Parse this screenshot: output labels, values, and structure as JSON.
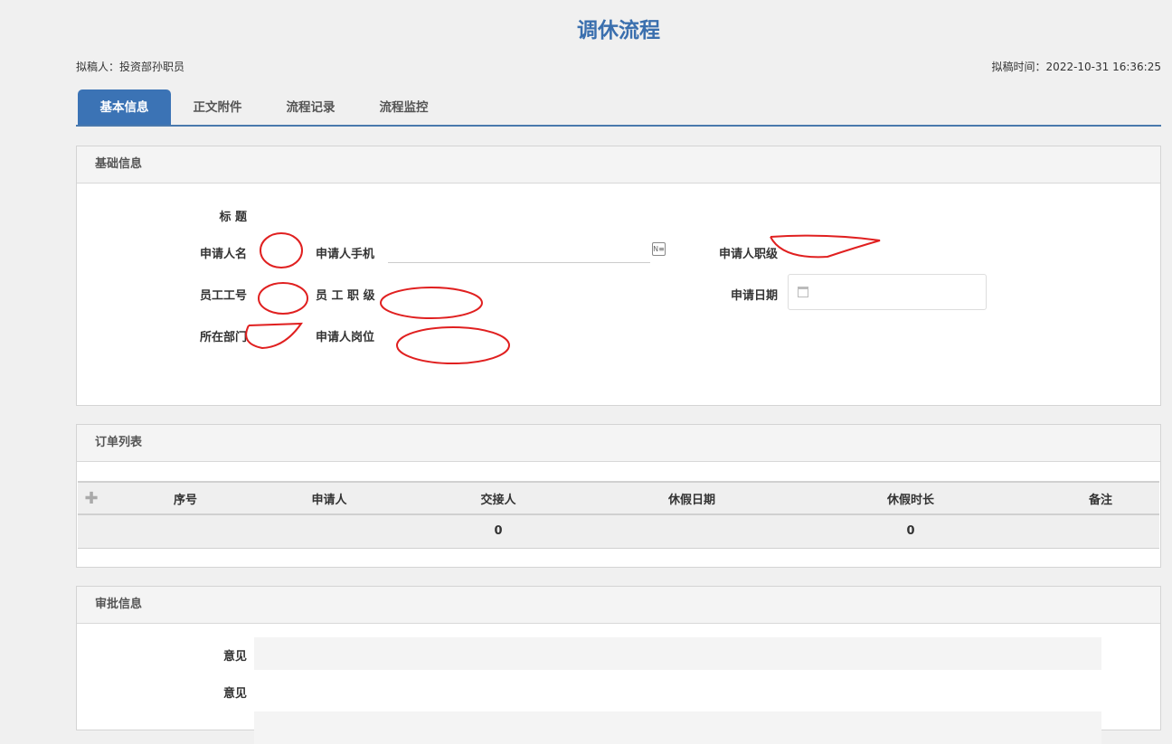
{
  "title": "调休流程",
  "drafter": "拟稿人：投资部孙职员",
  "draft_time": "拟稿时间：2022-10-31 16:36:25",
  "tabs": [
    {
      "label": "基本信息",
      "active": true
    },
    {
      "label": "正文附件"
    },
    {
      "label": "流程记录"
    },
    {
      "label": "流程监控"
    }
  ],
  "basic": {
    "header": "基础信息",
    "title_label": "标 题",
    "name_label": "申请人名",
    "phone_label": "申请人手机",
    "phone_value": "",
    "rank_label": "申请人职级",
    "emp_no_label": "员工工号",
    "emp_rank_label": "员 工 职 级",
    "date_label": "申请日期",
    "date_value": "",
    "dept_label": "所在部门",
    "post_label": "申请人岗位"
  },
  "orders": {
    "header": "订单列表",
    "columns": [
      "序号",
      "申请人",
      "交接人",
      "休假日期",
      "休假时长",
      "备注"
    ],
    "totals": [
      "",
      "",
      "0",
      "",
      "0",
      ""
    ]
  },
  "approval": {
    "header": "审批信息",
    "opinion1": "意见",
    "opinion2": "意见"
  },
  "colors": {
    "accent": "#3b73b5",
    "redact": "#e02020"
  }
}
